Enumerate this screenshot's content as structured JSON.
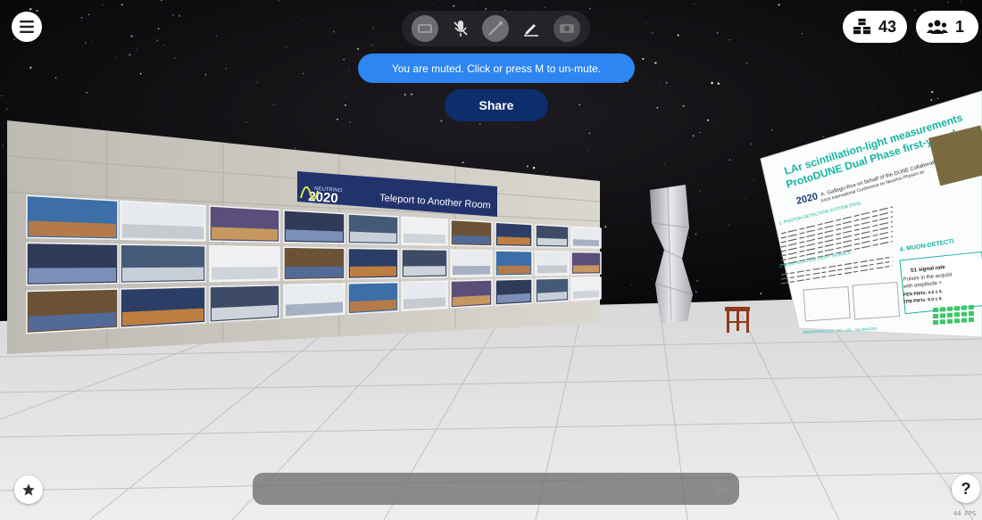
{
  "toolbar": {
    "tools": [
      {
        "name": "camera-icon"
      },
      {
        "name": "microphone-muted-icon"
      },
      {
        "name": "drawing-pen-icon"
      },
      {
        "name": "pencil-icon"
      },
      {
        "name": "media-icon"
      }
    ]
  },
  "counters": {
    "objects": "43",
    "people": "1"
  },
  "toast": {
    "message": "You are muted. Click or press M to un-mute."
  },
  "share": {
    "label": "Share"
  },
  "wall": {
    "banner_brand": "NEUTRINO",
    "banner_year": "2020",
    "banner_text": "Teleport to Another Room"
  },
  "poster": {
    "title_line1": "LAr scintillation-light measurements",
    "title_line2": "ProtoDUNE Dual Phase first-year d",
    "logo_year": "2020",
    "author": "A. Gallego-Ros on behalf of the DUNE Collaborati",
    "conference": "XXIX International Conference on Neutrino Physics an",
    "section1": "1. PHOTON-DETECTION SYSTEM (PDS)",
    "section2": "2. SCINTILLATION LIGHT SIGNALS",
    "section3": "4. MUON-DETECTI",
    "box_title": "S1 signal rate",
    "box_line1": "Pulses in the acquisi",
    "box_line2": "with amplitude >",
    "box_line3": "PEN PMTs: 4.5 ± 0.",
    "box_line4": "TPB PMTs: 9.0 ± 0.",
    "references": "REFERENCES [1] ... [2] ... [3] ... Neutrino2020"
  },
  "chat": {
    "placeholder": ""
  },
  "fps": "44 FPS",
  "colors": {
    "toast": "#2d86f2",
    "share": "#0d2d6b",
    "poster_accent": "#17b3a2"
  }
}
